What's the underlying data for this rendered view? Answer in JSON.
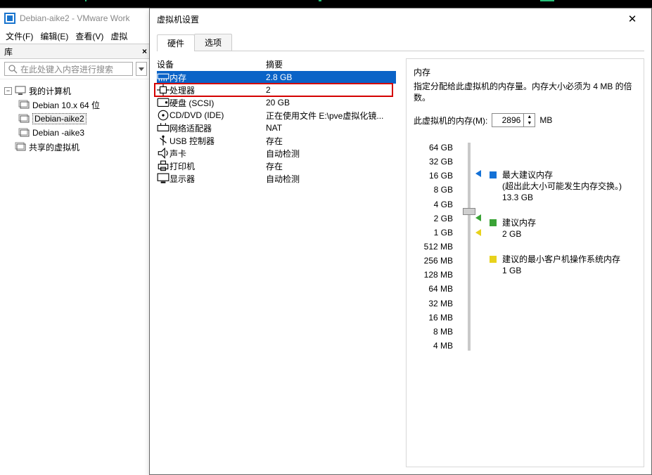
{
  "app": {
    "window_title": "Debian-aike2 - VMware Work"
  },
  "menus": {
    "file": "文件(F)",
    "edit": "编辑(E)",
    "view": "查看(V)",
    "vm": "虚拟"
  },
  "library": {
    "header": "库",
    "search_placeholder": "在此处键入内容进行搜索",
    "nodes": {
      "root": "我的计算机",
      "items": [
        "Debian 10.x 64 位",
        "Debian-aike2",
        "Debian -aike3"
      ],
      "shared": "共享的虚拟机"
    }
  },
  "dialog": {
    "title": "虚拟机设置",
    "tabs": {
      "hw": "硬件",
      "opt": "选项"
    },
    "headers": {
      "device": "设备",
      "summary": "摘要"
    },
    "devices": [
      {
        "icon": "mem",
        "name": "内存",
        "summary": "2.8 GB",
        "selected": true
      },
      {
        "icon": "cpu",
        "name": "处理器",
        "summary": "2",
        "highlight": true
      },
      {
        "icon": "hdd",
        "name": "硬盘 (SCSI)",
        "summary": "20 GB"
      },
      {
        "icon": "cd",
        "name": "CD/DVD (IDE)",
        "summary": "正在使用文件 E:\\pve虚拟化镜..."
      },
      {
        "icon": "net",
        "name": "网络适配器",
        "summary": "NAT"
      },
      {
        "icon": "usb",
        "name": "USB 控制器",
        "summary": "存在"
      },
      {
        "icon": "snd",
        "name": "声卡",
        "summary": "自动检测"
      },
      {
        "icon": "prn",
        "name": "打印机",
        "summary": "存在"
      },
      {
        "icon": "dsp",
        "name": "显示器",
        "summary": "自动检测"
      }
    ],
    "memory": {
      "title": "内存",
      "desc": "指定分配给此虚拟机的内存量。内存大小必须为 4 MB 的倍数。",
      "label": "此虚拟机的内存(M):",
      "value": "2896",
      "unit": "MB",
      "ticks": [
        "64 GB",
        "32 GB",
        "16 GB",
        "8 GB",
        "4 GB",
        "2 GB",
        "1 GB",
        "512 MB",
        "256 MB",
        "128 MB",
        "64 MB",
        "32 MB",
        "16 MB",
        "8 MB",
        "4 MB"
      ],
      "legend": {
        "max": {
          "label": "最大建议内存",
          "note": "(超出此大小可能发生内存交换。)",
          "val": "13.3 GB",
          "color": "#1471d6"
        },
        "rec": {
          "label": "建议内存",
          "val": "2 GB",
          "color": "#3aa336"
        },
        "min": {
          "label": "建议的最小客户机操作系统内存",
          "val": "1 GB",
          "color": "#e8d21c"
        }
      }
    }
  }
}
